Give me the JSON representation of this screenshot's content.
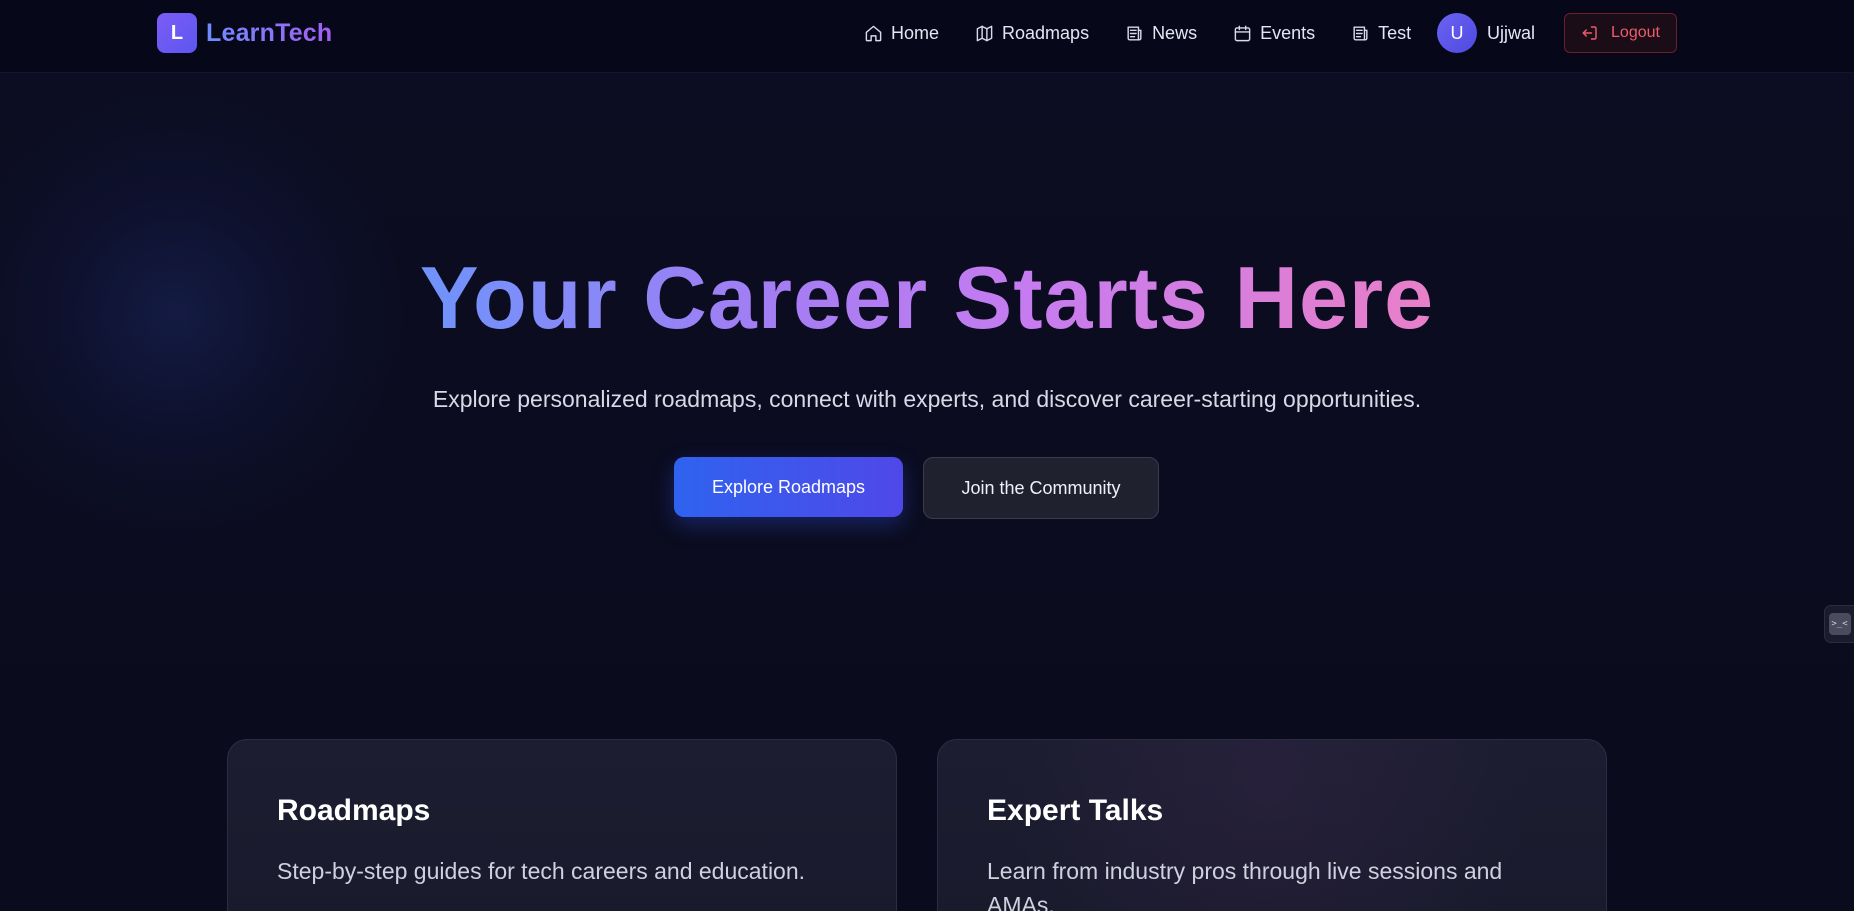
{
  "brand": {
    "logo_letter": "L",
    "name": "LearnTech"
  },
  "nav": {
    "items": [
      {
        "label": "Home",
        "icon": "home-icon"
      },
      {
        "label": "Roadmaps",
        "icon": "map-icon"
      },
      {
        "label": "News",
        "icon": "newspaper-icon"
      },
      {
        "label": "Events",
        "icon": "calendar-icon"
      },
      {
        "label": "Test",
        "icon": "newspaper-icon"
      }
    ],
    "user": {
      "initial": "U",
      "name": "Ujjwal"
    },
    "logout_label": "Logout"
  },
  "hero": {
    "title": "Your Career Starts Here",
    "subtitle": "Explore personalized roadmaps, connect with experts, and discover career-starting opportunities.",
    "primary_button": "Explore Roadmaps",
    "secondary_button": "Join the Community"
  },
  "side_widget": {
    "label": ">_<"
  },
  "features": [
    {
      "title": "Roadmaps",
      "description": "Step-by-step guides for tech careers and education."
    },
    {
      "title": "Expert Talks",
      "description": "Learn from industry pros through live sessions and AMAs."
    }
  ],
  "colors": {
    "background": "#0b0c1f",
    "navbar": "#07071a",
    "accent_blue": "#2f63ef",
    "accent_purple": "#7c5cf5",
    "logout_red": "#f05b6a",
    "card": "#1c1d30"
  }
}
